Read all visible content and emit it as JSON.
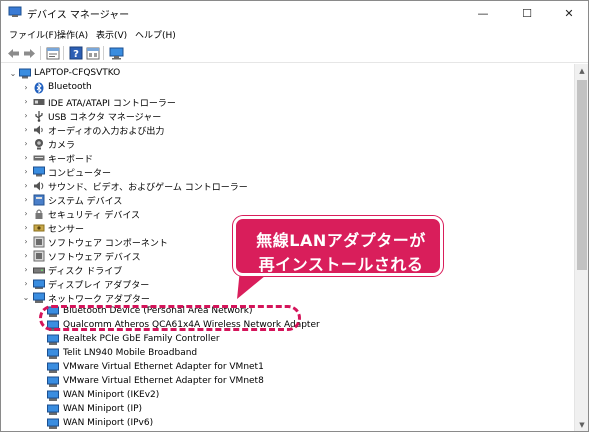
{
  "window": {
    "title": "デバイス マネージャー",
    "minimize": "—",
    "maximize": "☐",
    "close": "✕"
  },
  "menu": [
    "ファイル(F)",
    "操作(A)",
    "表示(V)",
    "ヘルプ(H)"
  ],
  "toolbar": {
    "icons": [
      "back-icon",
      "forward-icon",
      "properties-icon",
      "help-icon",
      "view-icon",
      "monitor-icon"
    ]
  },
  "tree": {
    "root": "LAPTOP-CFQSVTKO",
    "categories": [
      "Bluetooth",
      "IDE ATA/ATAPI コントローラー",
      "USB コネクタ マネージャー",
      "オーディオの入力および出力",
      "カメラ",
      "キーボード",
      "コンピューター",
      "サウンド、ビデオ、およびゲーム コントローラー",
      "システム デバイス",
      "セキュリティ デバイス",
      "センサー",
      "ソフトウェア コンポーネント",
      "ソフトウェア デバイス",
      "ディスク ドライブ",
      "ディスプレイ アダプター",
      "ネットワーク アダプター"
    ],
    "network_children": [
      "Bluetooth Device (Personal Area Network)",
      "Qualcomm Atheros QCA61x4A Wireless Network Adapter",
      "Realtek PCIe GbE Family Controller",
      "Telit LN940 Mobile Broadband",
      "VMware Virtual Ethernet Adapter for VMnet1",
      "VMware Virtual Ethernet Adapter for VMnet8",
      "WAN Miniport (IKEv2)",
      "WAN Miniport (IP)",
      "WAN Miniport (IPv6)"
    ]
  },
  "callout": {
    "line1": "無線LANアダプターが",
    "line2": "再インストールされる",
    "color": "#d91e5b"
  },
  "colors": {
    "arrow": "#555555",
    "highlight": "#d4145a"
  }
}
